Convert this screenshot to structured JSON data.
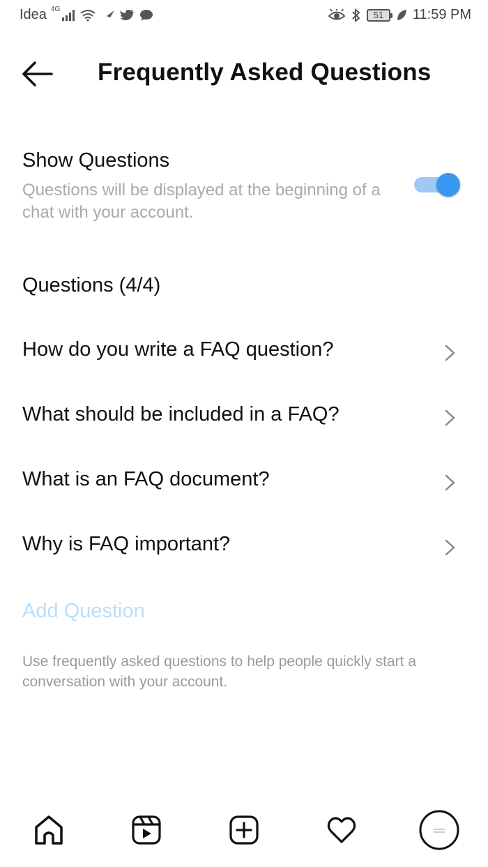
{
  "status_bar": {
    "carrier": "Idea",
    "network": "4G",
    "battery": "51",
    "time": "11:59 PM"
  },
  "header": {
    "title": "Frequently Asked Questions",
    "back_icon": "arrow-left-icon"
  },
  "show_questions": {
    "title": "Show Questions",
    "description": "Questions will be displayed at the beginning of a chat with your account.",
    "toggle_on": true,
    "accent_color": "#3897f0"
  },
  "questions": {
    "heading": "Questions (4/4)",
    "items": [
      {
        "label": "How do you write a FAQ question?"
      },
      {
        "label": "What should be included in a FAQ?"
      },
      {
        "label": "What is an FAQ document?"
      },
      {
        "label": "Why is FAQ important?"
      }
    ],
    "add_label": "Add Question",
    "add_color": "#b6e0fb"
  },
  "footer_note": "Use frequently asked questions to help people quickly start a conversation with your account.",
  "bottom_nav": {
    "items": [
      "home-icon",
      "reels-icon",
      "new-post-icon",
      "activity-heart-icon",
      "profile-avatar-icon"
    ]
  }
}
